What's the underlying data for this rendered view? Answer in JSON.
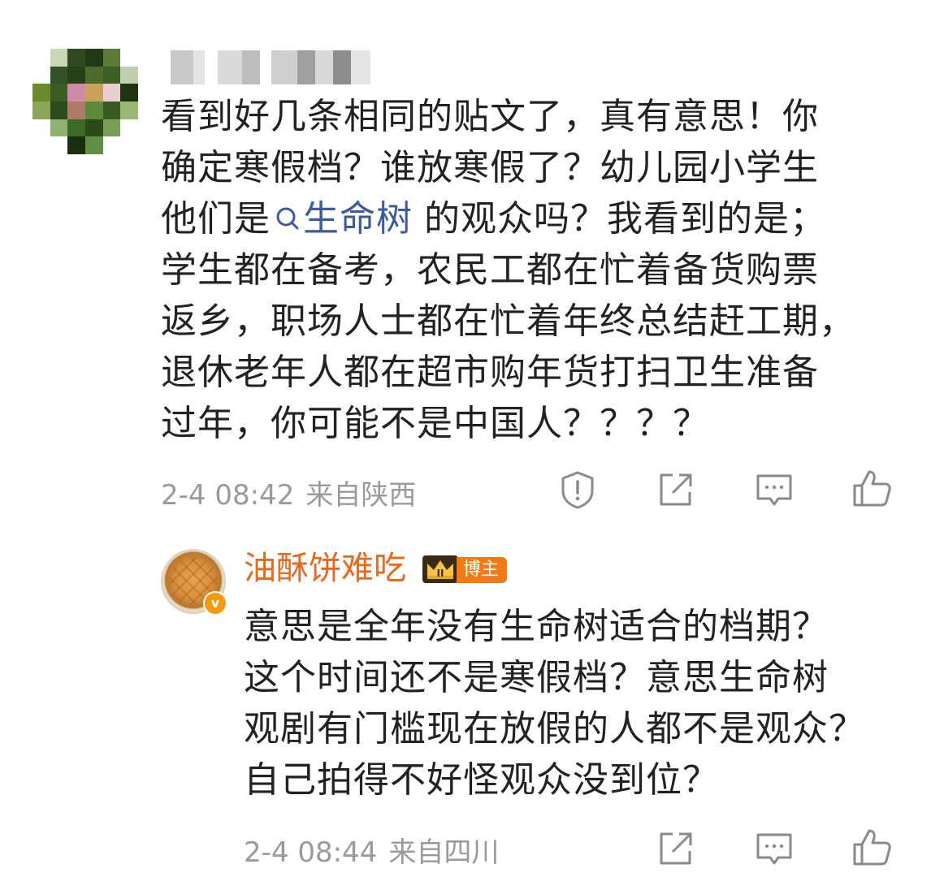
{
  "main_comment": {
    "text_lines": [
      "看到好几条相同的贴文了，真有意思！你",
      "确定寒假档？谁放寒假了？幼儿园小学生",
      "学生都在备考，农民工都在忙着备货购票",
      "返乡，职场人士都在忙着年终总结赶工期，",
      "退休老年人都在超市购年货打扫卫生准备",
      "过年，你可能不是中国人？？？？"
    ],
    "line3_before": "他们是",
    "topic_link": "生命树",
    "line3_after": "的观众吗？我看到的是；",
    "date": "2-4 08:42",
    "location": "来自陕西",
    "actions": [
      "report-icon",
      "share-icon",
      "comment-icon",
      "like-icon"
    ]
  },
  "reply": {
    "username": "油酥饼难吃",
    "badge": "博主",
    "text_lines": [
      "意思是全年没有生命树适合的档期？",
      "这个时间还不是寒假档？意思生命树",
      "观剧有门槛现在放假的人都不是观众？",
      "自己拍得不好怪观众没到位？"
    ],
    "date": "2-4 08:44",
    "location": "来自四川",
    "actions": [
      "share-icon",
      "comment-icon",
      "like-icon"
    ]
  },
  "colors": {
    "text": "#222222",
    "meta": "#9a9a9a",
    "link": "#3b5b9a",
    "reply_username": "#e8681c",
    "badge_bg": "#f07a16"
  }
}
